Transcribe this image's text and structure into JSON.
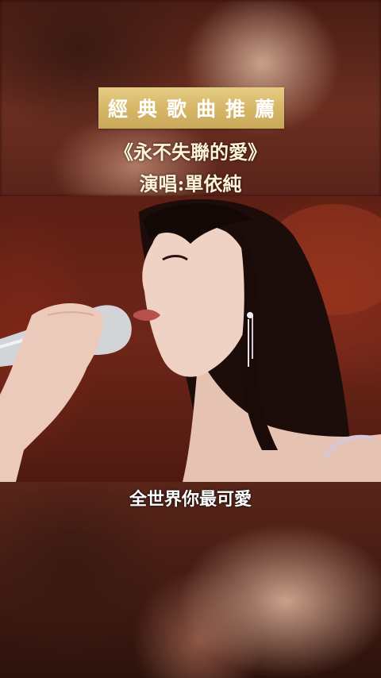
{
  "overlay": {
    "banner_text": "經典歌曲推薦",
    "song_title": "《永不失聯的愛》",
    "singer_line": "演唱:單依純"
  },
  "video": {
    "subtitle": "全世界你最可愛",
    "subject": "singer-with-microphone"
  },
  "colors": {
    "banner_gold": "#d6b768",
    "title_text": "#fff3d9",
    "background_red": "#6e2618"
  }
}
